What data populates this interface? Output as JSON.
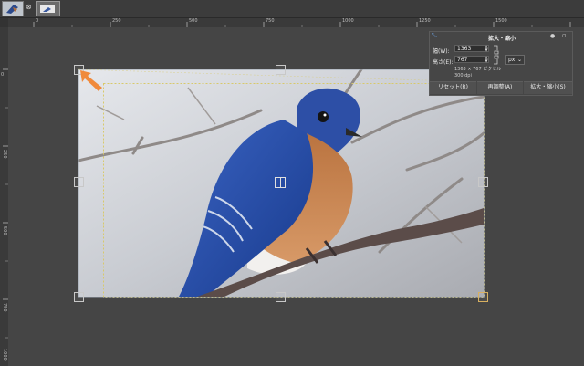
{
  "image_tabs": [
    {
      "name": "bluebird-thumbnail"
    },
    {
      "name": "image-thumbnail-2"
    }
  ],
  "rulers": {
    "horizontal_ticks": [
      "0",
      "250",
      "500",
      "750",
      "1000",
      "1250",
      "1500"
    ],
    "vertical_ticks": [
      "0",
      "250",
      "500",
      "750",
      "1000"
    ]
  },
  "dialog": {
    "title": "拡大・縮小",
    "width_label": "幅(W):",
    "width_value": "1363",
    "height_label": "高さ(E):",
    "height_value": "767",
    "unit": "px",
    "pixel_info": "1363 × 767 ピクセル",
    "dpi_info": "300 dpi",
    "reset_button": "リセット(R)",
    "readjust_button": "再調整(A)",
    "scale_button": "拡大・縮小(S)"
  },
  "colors": {
    "canvas_bg": "#454545",
    "dialog_bg": "#464646",
    "arrow": "#f08a3c",
    "selection_dash": "#d8c96a"
  }
}
